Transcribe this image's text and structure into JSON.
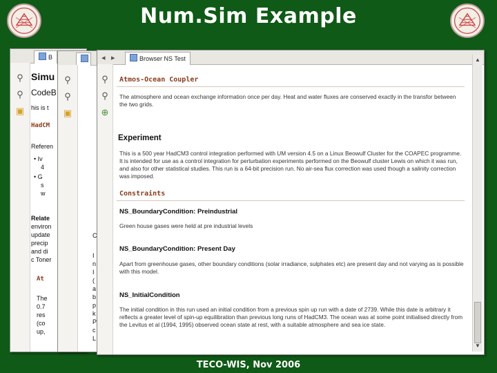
{
  "slide": {
    "title": "Num.Sim Example",
    "footer": "TECO-WIS, Nov 2006"
  },
  "window_back": {
    "tab_label": "B",
    "heading1": "Simu",
    "heading2": "CodeB",
    "line_a": "his is t",
    "section1": "HadCM",
    "ref_label": "Referen",
    "bullet1a": "Iv",
    "bullet1b": "4",
    "bullet2a": "G",
    "bullet2b": "s",
    "bullet2c": "w",
    "related": "Relate",
    "r1": "environ",
    "r2": "update",
    "r3": "precip",
    "r4": "and di",
    "r5": "c Toner",
    "section2": "At",
    "s1": "The",
    "s2": "0.7",
    "s3": "res",
    "s4": "(co",
    "s5": "up,"
  },
  "window_mid": {
    "c1": "C",
    "lines": [
      "I",
      "n",
      "I",
      "(",
      "a",
      "b",
      "p",
      "k",
      "P",
      "c",
      "L"
    ]
  },
  "window_front": {
    "tab_label": "Browser NS Test",
    "coupler_title": "Atmos-Ocean Coupler",
    "coupler_text": "The atmosphere and ocean exchange information once per day. Heat and water fluxes are conserved exactly in the transfor between the two grids.",
    "experiment_heading": "Experiment",
    "experiment_text": "This is a 500 year HadCM3 control integration performed with UM version 4.5 on a Linux Beowulf Cluster for the COAPEC programme. It is intended for use as a control integration for perturbation experiments performed on the Beowulf cluster Lewis on which it was run, and also for other statistical studies. This run is a 64-bit precision run. No air-sea flux correction was used though a salinity correction was imposed.",
    "constraints_title": "Constraints",
    "c1_heading": "NS_BoundaryCondition: Preindustrial",
    "c1_text": "Green house gases were held at pre industrial levels",
    "c2_heading": "NS_BoundaryCondition: Present Day",
    "c2_text": "Apart from greenhouse gases, other boundary conditions (solar irradiance, sulphates etc) are present day and not varying as is possible with this model.",
    "c3_heading": "NS_InitialCondition",
    "c3_text": "The initial condition in this run used an initial condition from a previous spin up run with a date of 2739. While this date is arbitrary it reflects a greater level of spin-up equilibration than previous long runs of HadCM3. The ocean was at some point initialised directly from the Levitus et al (1994, 1995) observed ocean state at rest, with a suitable atmosphere and sea ice state."
  }
}
